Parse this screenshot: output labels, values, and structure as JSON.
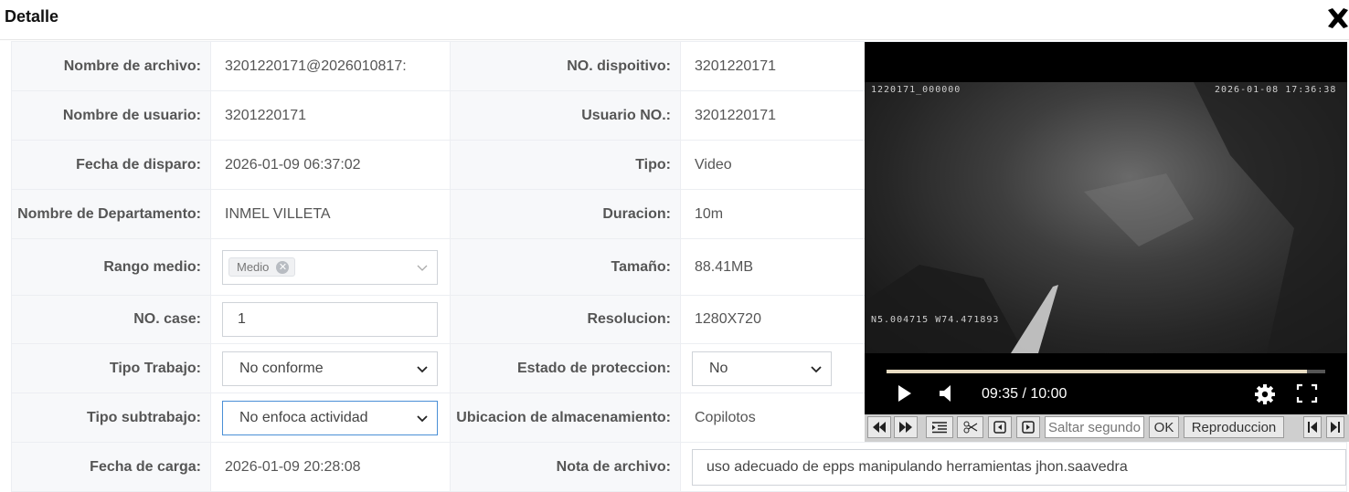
{
  "dialog": {
    "title": "Detalle"
  },
  "rows": [
    {
      "l1": "Nombre de archivo:",
      "v1": "3201220171@2026010817:",
      "l2": "NO. dispoitivo:",
      "v2": "3201220171"
    },
    {
      "l1": "Nombre de usuario:",
      "v1": "3201220171",
      "l2": "Usuario NO.:",
      "v2": "3201220171"
    },
    {
      "l1": "Fecha de disparo:",
      "v1": "2026-01-09 06:37:02",
      "l2": "Tipo:",
      "v2": "Video"
    },
    {
      "l1": "Nombre de Departamento:",
      "v1": "INMEL VILLETA",
      "l2": "Duracion:",
      "v2": "10m"
    },
    {
      "l1": "Rango medio:",
      "v1": "Medio",
      "l2": "Tamaño:",
      "v2": "88.41MB"
    },
    {
      "l1": "NO. case:",
      "v1": "1",
      "l2": "Resolucion:",
      "v2": "1280X720"
    },
    {
      "l1": "Tipo Trabajo:",
      "v1": "No conforme",
      "l2": "Estado de proteccion:",
      "v2": "No"
    },
    {
      "l1": "Tipo subtrabajo:",
      "v1": "No enfoca actividad",
      "l2": "Ubicacion de almacenamiento:",
      "v2": "Copilotos"
    },
    {
      "l1": "Fecha de carga:",
      "v1": "2026-01-09 20:28:08",
      "l2": "Nota de archivo:",
      "v2": "uso adecuado de epps manipulando herramientas  jhon.saavedra"
    }
  ],
  "video": {
    "osd_top_left": "1220171_000000",
    "osd_top_right": "2026-01-08 17:36:38",
    "osd_bottom_left": "N5.004715 W74.471893",
    "time": "09:35 / 10:00",
    "progress": 0.958
  },
  "toolbar": {
    "seek_placeholder": "Saltar segundos",
    "ok_label": "OK",
    "play_label": "Reproduccion"
  },
  "icons": [
    "close-icon",
    "chevron-down-icon",
    "play-icon",
    "volume-icon",
    "settings-icon",
    "fullscreen-icon",
    "rewind-icon",
    "fast-forward-icon",
    "list-icon",
    "scissors-icon",
    "frame-back-icon",
    "frame-forward-icon",
    "skip-start-icon",
    "skip-end-icon"
  ]
}
